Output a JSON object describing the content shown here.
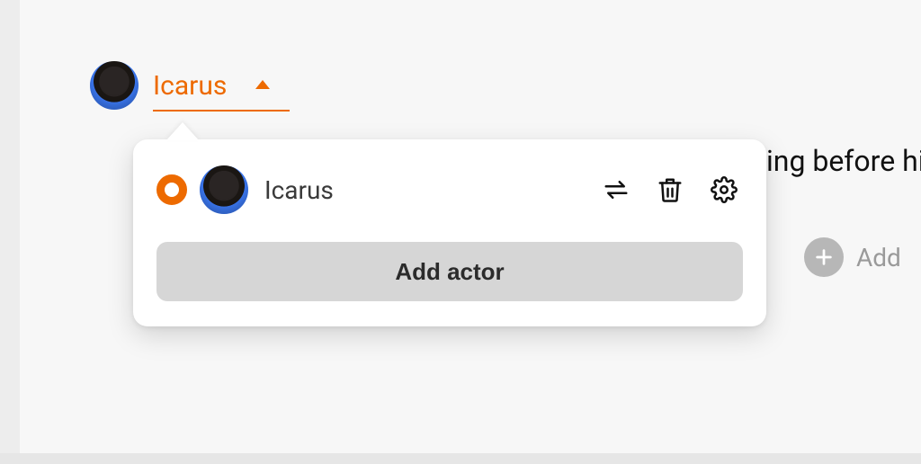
{
  "trigger": {
    "actor_name": "Icarus"
  },
  "popover": {
    "actors": [
      {
        "name": "Icarus",
        "selected": true
      }
    ],
    "add_actor_label": "Add actor"
  },
  "background": {
    "partial_text": "ing before hi",
    "add_label": "Add"
  },
  "icons": {
    "swap": "swap-icon",
    "trash": "trash-icon",
    "gear": "gear-icon",
    "plus": "plus-icon",
    "caret_up": "caret-up-icon"
  },
  "colors": {
    "accent": "#ed6a00",
    "button_bg": "#d6d6d6"
  }
}
